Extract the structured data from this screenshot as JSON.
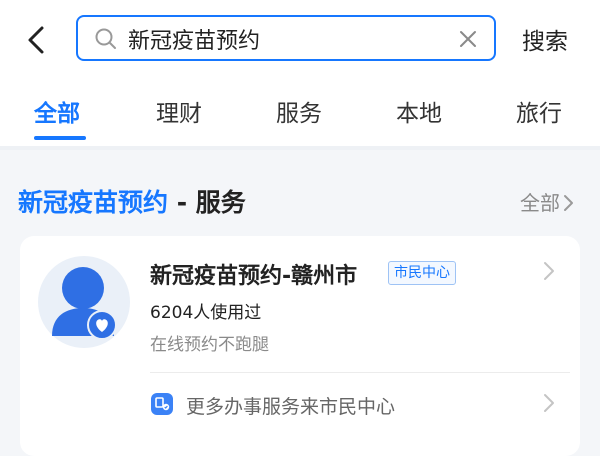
{
  "header": {
    "search": {
      "value": "新冠疫苗预约"
    },
    "search_action": "搜索"
  },
  "tabs": [
    {
      "label": "全部",
      "active": true
    },
    {
      "label": "理财",
      "active": false
    },
    {
      "label": "服务",
      "active": false
    },
    {
      "label": "本地",
      "active": false
    },
    {
      "label": "旅行",
      "active": false
    }
  ],
  "section": {
    "title_highlight": "新冠疫苗预约",
    "title_rest": " - 服务",
    "all_link": "全部"
  },
  "service_card": {
    "name": "新冠疫苗预约-赣州市",
    "badge": "市民中心",
    "usage": "6204人使用过",
    "description": "在线预约不跑腿",
    "more_link": "更多办事服务来市民中心"
  },
  "colors": {
    "accent": "#1677ff",
    "background": "#f4f6f9",
    "secondary_text": "#8a8a8a"
  },
  "icons": {
    "back": "chevron-left-icon",
    "search": "search-icon",
    "clear": "close-icon",
    "avatar": "user-heart-icon",
    "more": "service-center-icon",
    "chevron": "chevron-right-icon"
  }
}
